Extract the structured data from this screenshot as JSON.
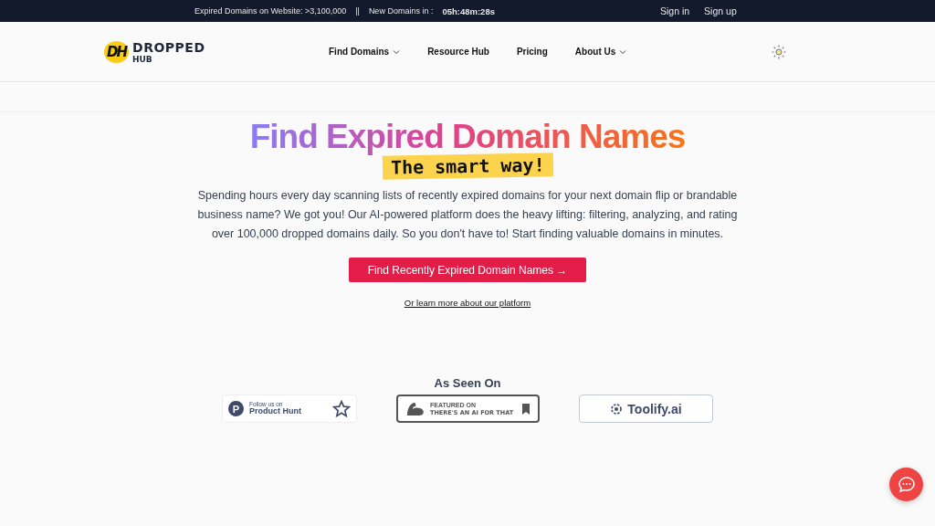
{
  "top_bar": {
    "expired_label": "Expired Domains on Website: >3,100,000",
    "separator": "||",
    "new_label": "New Domains in :",
    "countdown": "05h:48m:28s",
    "links": [
      "Sign in",
      "Sign up"
    ]
  },
  "logo": {
    "mark": "DH",
    "name": "DROPPED",
    "sub": "HUB"
  },
  "nav": [
    {
      "label": "Find Domains",
      "dropdown": true
    },
    {
      "label": "Resource Hub",
      "dropdown": false
    },
    {
      "label": "Pricing",
      "dropdown": false
    },
    {
      "label": "About Us",
      "dropdown": true
    }
  ],
  "hero": {
    "title": "Find Expired Domain Names",
    "subtitle": "The smart way!",
    "description": "Spending hours every day scanning lists of recently expired domains for your next domain flip or brandable business name? We got you! Our AI-powered platform does the heavy lifting: filtering, analyzing, and rating over 100,000 dropped domains daily. So you don't have to! Start finding valuable domains in minutes.",
    "cta": "Find Recently Expired Domain Names →",
    "secondary_link": "Or learn more about our platform"
  },
  "as_seen_on": {
    "heading": "As Seen On",
    "badges": [
      {
        "kind": "producthunt",
        "small": "Follow us on",
        "name": "Product Hunt",
        "mark": "P"
      },
      {
        "kind": "aiforthat",
        "small": "FEATURED ON",
        "name": "THERE'S AN AI FOR THAT"
      },
      {
        "kind": "toolify",
        "name": "Toolify.ai"
      }
    ]
  }
}
